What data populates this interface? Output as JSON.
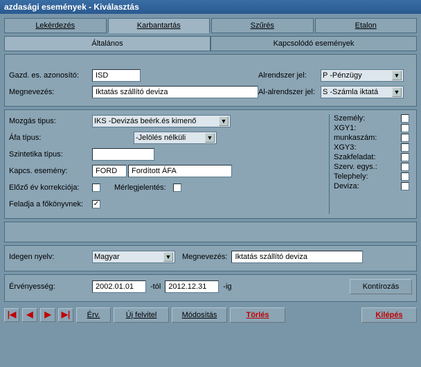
{
  "title": "azdasági események - Kiválasztás",
  "mainTabs": [
    "Lekérdezés",
    "Karbantartás",
    "Szűrés",
    "Etalon"
  ],
  "subTabs": [
    "Általános",
    "Kapcsolódó események"
  ],
  "labels": {
    "gazdId": "Gazd. es. azonosító:",
    "megnev": "Megnevezés:",
    "alrendszer": "Alrendszer jel:",
    "alalrendszer": "Al-alrendszer jel:",
    "mozgas": "Mozgás tipus:",
    "afa": "Áfa típus:",
    "szint": "Szintetika típus:",
    "kapcs": "Kapcs. esemény:",
    "elozo": "Előző év korrekciója:",
    "merleg": "Mérlegjelentés:",
    "feladja": "Feladja a főkönyvnek:",
    "idegen": "Idegen nyelv:",
    "megnev2": "Megnevezés:",
    "erveny": "Érvényesség:",
    "tol": "-tól",
    "ig": "-ig"
  },
  "values": {
    "gazdId": "ISD",
    "megnev": "Iktatás szállító deviza",
    "alrendszer": "P -Pénzügy",
    "alalrendszer": "S -Számla iktatá",
    "mozgas": "IKS -Devizás beérk.és kimenő",
    "afa": "-Jelölés nélküli",
    "szint": "",
    "kapcs1": "FORD",
    "kapcs2": "Fordított ÁFA",
    "idegen": "Magyar",
    "megnev2": "Iktatás szállító deviza",
    "date1": "2002.01.01",
    "date2": "2012.12.31"
  },
  "sideChecks": [
    "Személy:",
    "XGY1:",
    "munkaszám:",
    "XGY3:",
    "Szakfeladat:",
    "Szerv. egys.:",
    "Telephely:",
    "Deviza:"
  ],
  "buttons": {
    "kontir": "Kontírozás",
    "erv": "Érv.",
    "uj": "Új felvitel",
    "modos": "Módosítás",
    "torles": "Törlés",
    "kilepes": "Kilépés"
  },
  "nav": [
    "|◀",
    "◀",
    "▶",
    "▶|"
  ]
}
